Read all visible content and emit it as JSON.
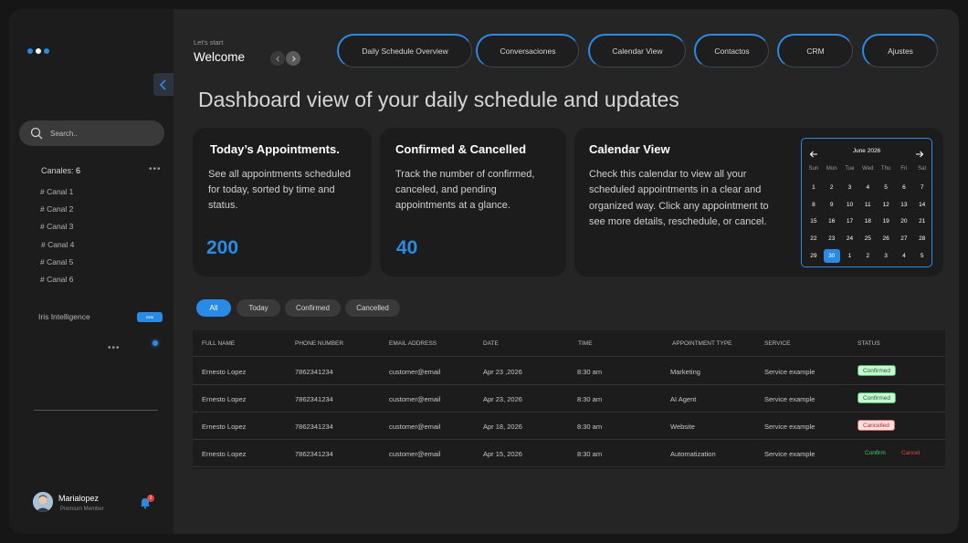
{
  "sidebar": {
    "search_placeholder": "Search..",
    "canales_label": "Canales:",
    "canales_count": "6",
    "canales_more": "•••",
    "channels": [
      "# Canal 1",
      "# Canal 2",
      "# Canal 3",
      "# Canal 4",
      "# Canal 5",
      "# Canal 6"
    ],
    "iris_label": "Iris Intelligence",
    "iris_badge": "new",
    "iris_more": "•••",
    "user_name": "Marialopez",
    "user_role": "Premium Member",
    "notification_count": "2"
  },
  "header": {
    "lets_start": "Let's start",
    "welcome": "Welcome",
    "tabs": [
      "Daily  Schedule Overview",
      "Conversaciones",
      "Calendar View",
      "Contactos",
      "CRM",
      "Ajustes"
    ]
  },
  "page_title": "Dashboard view of your daily schedule and updates",
  "cards": {
    "appointments": {
      "title": "Today’s Appointments.",
      "desc": "See all appointments scheduled for today, sorted by time and status.",
      "value": "200"
    },
    "confirmed": {
      "title": "Confirmed & Cancelled",
      "desc": "Track the number of confirmed, canceled, and pending appointments at a glance.",
      "value": "40"
    },
    "calendar": {
      "title": "Calendar View",
      "desc": "Check this calendar to view all your scheduled appointments in a clear and organized way. Click any appointment to see more details, reschedule, or cancel."
    }
  },
  "calendar": {
    "month": "June 2026",
    "dow": [
      "Sun",
      "Mon",
      "Tue",
      "Wed",
      "Thu",
      "Fri",
      "Sat"
    ],
    "days": [
      "1",
      "2",
      "3",
      "4",
      "5",
      "6",
      "7",
      "8",
      "9",
      "10",
      "11",
      "12",
      "13",
      "14",
      "15",
      "16",
      "17",
      "18",
      "19",
      "20",
      "21",
      "22",
      "23",
      "24",
      "25",
      "26",
      "27",
      "28",
      "29",
      "30",
      "1",
      "2",
      "3",
      "4",
      "5"
    ],
    "selected_index": 29
  },
  "filters": [
    "All",
    "Today",
    "Confirmed",
    "Cancelled"
  ],
  "table": {
    "headers": [
      "FULL NAME",
      "PHONE NUMBER",
      "EMAIL ADDRESS",
      "DATE",
      "TIME",
      "APPOINTMENT TYPE",
      "SERVICE",
      "STATUS"
    ],
    "rows": [
      {
        "name": "Ernesto Lopez",
        "phone": "7862341234",
        "email": "customer@email",
        "date": "Apr 23 ,2026",
        "time": "8:30 am",
        "type": "Marketing",
        "service": "Service example",
        "status": "Confirmed"
      },
      {
        "name": "Ernesto Lopez",
        "phone": "7862341234",
        "email": "customer@email",
        "date": "Apr 23, 2026",
        "time": "8:30 am",
        "type": "AI Agent",
        "service": "Service example",
        "status": "Confirmed"
      },
      {
        "name": "Ernesto Lopez",
        "phone": "7862341234",
        "email": "customer@email",
        "date": "Apr 18, 2026",
        "time": "8:30 am",
        "type": "Website",
        "service": "Service example",
        "status": "Cancelled"
      },
      {
        "name": "Ernesto Lopez",
        "phone": "7862341234",
        "email": "customer@email",
        "date": "Apr 15, 2026",
        "time": "8:30 am",
        "type": "Automatization",
        "service": "Service example",
        "confirm_label": "Confirm",
        "cancel_label": "Cancel"
      }
    ]
  },
  "colors": {
    "accent": "#2a8be6",
    "confirmed_bg": "#c9f6d3",
    "cancelled_bg": "#fbe0e0"
  }
}
